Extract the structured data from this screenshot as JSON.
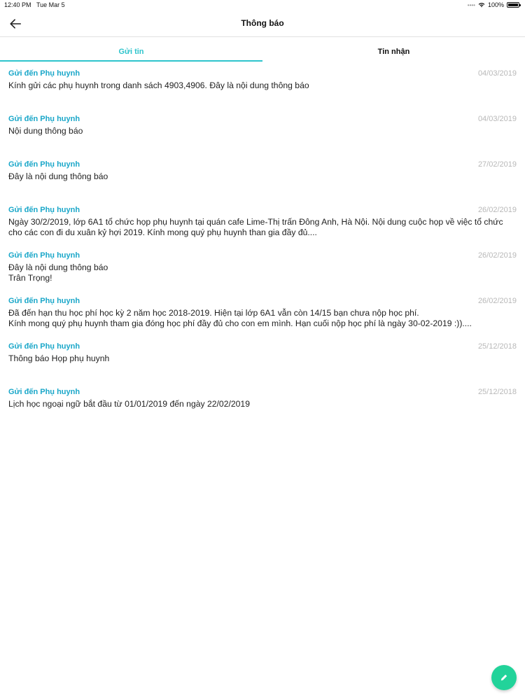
{
  "status_bar": {
    "time": "12:40 PM",
    "date": "Tue Mar 5",
    "battery": "100%",
    "battery_level": 1.0,
    "icons": [
      "signal-icon",
      "wifi-icon",
      "battery-icon"
    ]
  },
  "header": {
    "title": "Thông báo",
    "back_icon": "arrow-left-icon"
  },
  "tabs": [
    {
      "label": "Gửi tin",
      "active": true
    },
    {
      "label": "Tin nhận",
      "active": false
    }
  ],
  "notifications": [
    {
      "recipient": "Gửi đến Phụ huynh",
      "date": "04/03/2019",
      "content": "Kính gửi các phụ huynh trong danh sách 4903,4906. Đây là nội dung thông báo"
    },
    {
      "recipient": "Gửi đến Phụ huynh",
      "date": "04/03/2019",
      "content": "Nội dung thông báo"
    },
    {
      "recipient": "Gửi đến Phụ huynh",
      "date": "27/02/2019",
      "content": "Đây là nội dung thông báo"
    },
    {
      "recipient": "Gửi đến Phụ huynh",
      "date": "26/02/2019",
      "content": "Ngày 30/2/2019, lớp 6A1 tổ chức họp phụ huynh tại quán cafe Lime-Thị trấn Đông Anh, Hà Nội. Nội dung cuộc họp về việc tổ chức cho các con đi du xuân kỷ hợi 2019. Kính mong quý phụ huynh than gia đầy đủ...."
    },
    {
      "recipient": "Gửi đến Phụ huynh",
      "date": "26/02/2019",
      "content": "Đây là nội dung thông báo\nTrân Trọng!"
    },
    {
      "recipient": "Gửi đến Phụ huynh",
      "date": "26/02/2019",
      "content": "Đã đến hạn thu học phí học kỳ 2 năm học 2018-2019. Hiện tại lớp 6A1 vẫn còn 14/15 bạn chưa nộp học phí.\nKính mong quý phụ huynh tham gia đóng học phí đầy đủ cho con em mình. Hạn cuối nộp học phí là ngày 30-02-2019 :))...."
    },
    {
      "recipient": "Gửi đến Phụ huynh",
      "date": "25/12/2018",
      "content": "Thông báo Họp phụ huynh"
    },
    {
      "recipient": "Gửi đến Phụ huynh",
      "date": "25/12/2018",
      "content": "Lịch học ngoại ngữ bắt đầu từ 01/01/2019 đến ngày 22/02/2019"
    }
  ],
  "fab": {
    "icon": "pencil-icon",
    "color": "#22d39a"
  },
  "colors": {
    "accent": "#2ec4cc",
    "recipient": "#1aa7c9",
    "date": "#b8b8b8"
  }
}
